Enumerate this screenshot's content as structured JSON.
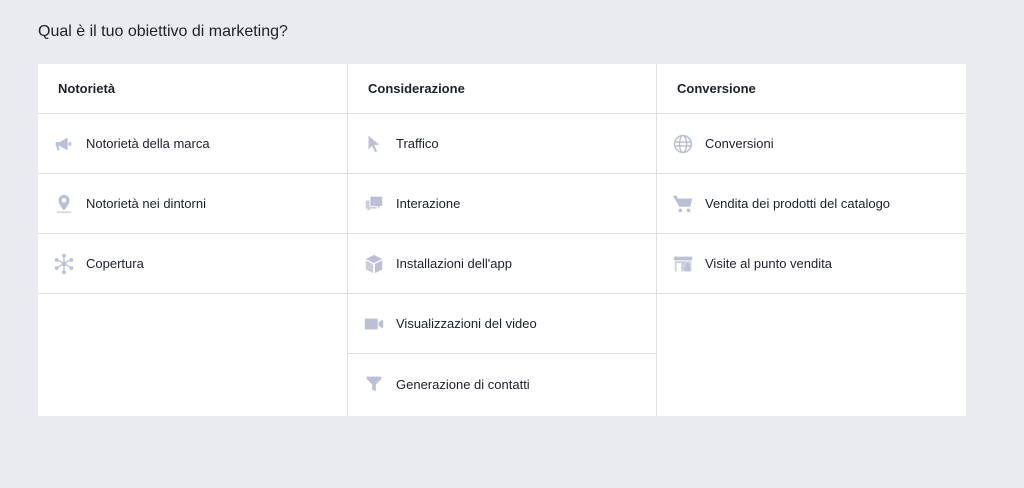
{
  "title": "Qual è il tuo obiettivo di marketing?",
  "columns": [
    {
      "header": "Notorietà",
      "items": [
        {
          "label": "Notorietà della marca",
          "icon": "megaphone-icon"
        },
        {
          "label": "Notorietà nei dintorni",
          "icon": "location-pin-icon"
        },
        {
          "label": "Copertura",
          "icon": "reach-burst-icon"
        }
      ]
    },
    {
      "header": "Considerazione",
      "items": [
        {
          "label": "Traffico",
          "icon": "cursor-icon"
        },
        {
          "label": "Interazione",
          "icon": "chat-bubbles-icon"
        },
        {
          "label": "Installazioni dell'app",
          "icon": "box-icon"
        },
        {
          "label": "Visualizzazioni del video",
          "icon": "video-camera-icon"
        },
        {
          "label": "Generazione di contatti",
          "icon": "funnel-icon"
        }
      ]
    },
    {
      "header": "Conversione",
      "items": [
        {
          "label": "Conversioni",
          "icon": "globe-icon"
        },
        {
          "label": "Vendita dei prodotti del catalogo",
          "icon": "shopping-cart-icon"
        },
        {
          "label": "Visite al punto vendita",
          "icon": "storefront-icon"
        }
      ]
    }
  ],
  "colors": {
    "background": "#e9ebee",
    "panel": "#ffffff",
    "border": "#dddfe2",
    "icon": "#bcc0d6",
    "text": "#1d2129"
  }
}
